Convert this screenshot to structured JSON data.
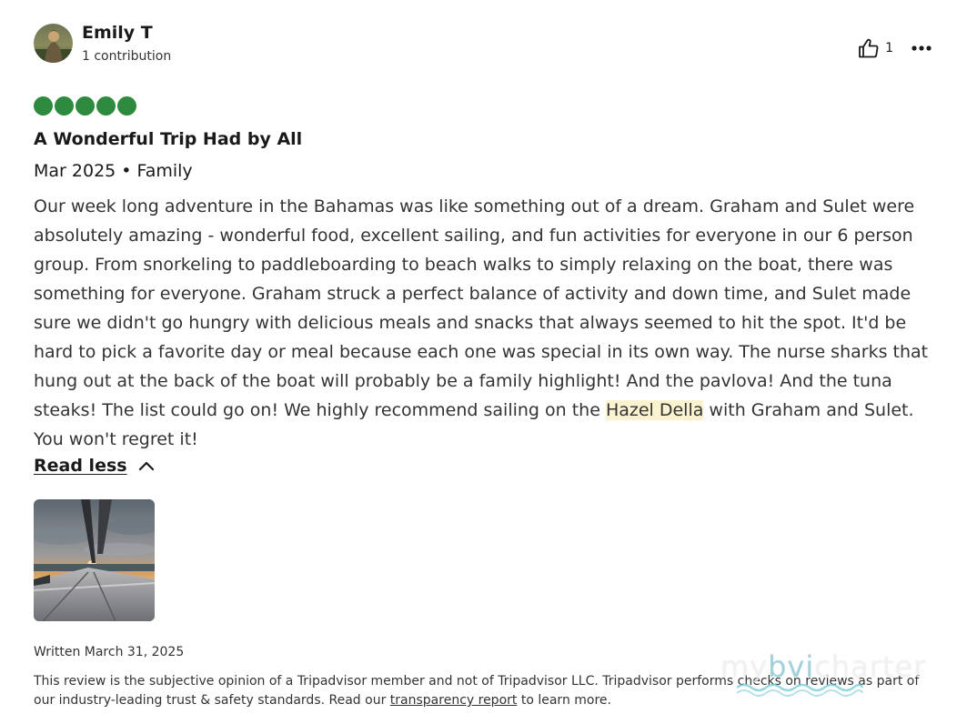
{
  "reviewer": {
    "name": "Emily T",
    "contributions": "1 contribution",
    "avatar_icon": "avatar-photo"
  },
  "actions": {
    "helpful_count": "1",
    "helpful_icon": "thumbs-up-icon",
    "more_icon": "more-options-icon"
  },
  "rating": {
    "value": 5,
    "max": 5,
    "color": "#2e8a3e"
  },
  "review": {
    "title": "A Wonderful Trip Had by All",
    "meta": "Mar 2025 • Family",
    "body_before": "Our week long adventure in the Bahamas was like something out of a dream. Graham and Sulet were absolutely amazing - wonderful food, excellent sailing, and fun activities for everyone in our 6 person group. From snorkeling to paddleboarding to beach walks to simply relaxing on the boat, there was something for everyone. Graham struck a perfect balance of activity and down time, and Sulet made sure we didn't go hungry with delicious meals and snacks that always seemed to hit the spot. It'd be hard to pick a favorite day or meal because each one was special in its own way. The nurse sharks that hung out at the back of the boat will probably be a family highlight! And the pavlova! And the tuna steaks! The list could go on! We highly recommend sailing on the ",
    "body_highlight": "Hazel Della",
    "body_after": " with Graham and Sulet. You won't regret it!",
    "highlight_color": "#fbf3d0",
    "read_less_label": "Read less",
    "read_less_icon": "chevron-up-icon"
  },
  "photo": {
    "description_icon": "review-photo"
  },
  "footer": {
    "written": "Written March 31, 2025",
    "disclaimer_before": "This review is the subjective opinion of a Tripadvisor member and not of Tripadvisor LLC. Tripadvisor performs checks on reviews as part of our industry-leading trust & safety standards. Read our ",
    "disclaimer_link": "transparency report",
    "disclaimer_after": " to learn more."
  },
  "watermark": {
    "part1": "my",
    "part2": "bvi",
    "part3": "charter"
  }
}
